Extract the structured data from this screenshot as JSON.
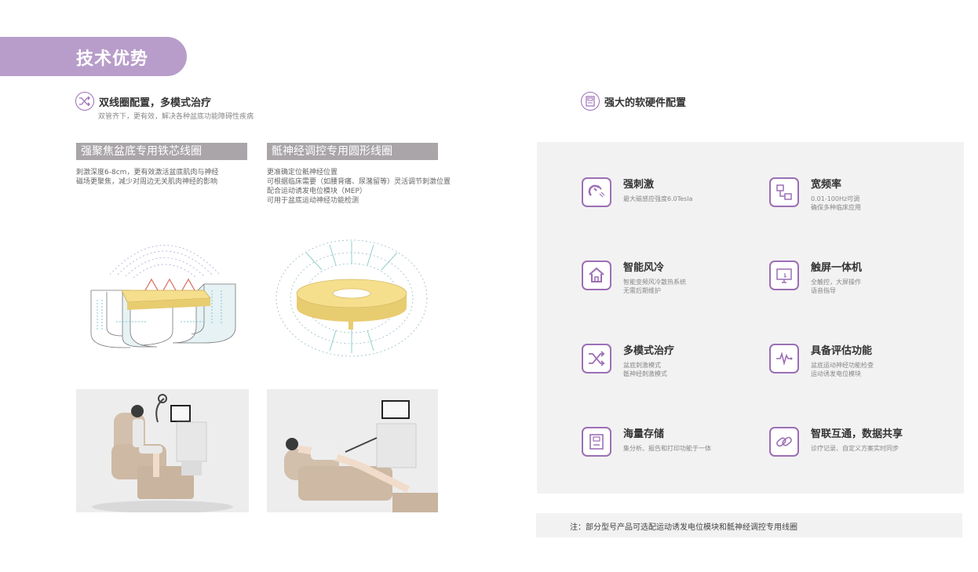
{
  "banner": {
    "title": "技术优势"
  },
  "left_section": {
    "title": "双线圈配置，多模式治疗",
    "subtitle": "双管齐下，更有效，解决各种盆底功能障碍性疾病",
    "coils": [
      {
        "label": "强聚焦盆底专用铁芯线圈",
        "desc": [
          "刺激深度6-8cm，更有效激活盆底肌肉与神经",
          "磁场更聚焦，减少对周边无关肌肉神经的影响"
        ]
      },
      {
        "label": "骶神经调控专用圆形线圈",
        "desc": [
          "更准确定位骶神经位置",
          "可根据临床需要（如腰背痛、尿潴留等）灵活调节刺激位置",
          "配合运动诱发电位模块（MEP）",
          "可用于盆底运动神经功能检测"
        ]
      }
    ]
  },
  "right_section": {
    "title": "强大的软硬件配置",
    "features": [
      {
        "icon": "magnet-icon",
        "title": "强刺激",
        "lines": [
          "最大磁感应强度6.0Tesla"
        ]
      },
      {
        "icon": "frequency-icon",
        "title": "宽频率",
        "lines": [
          "0.01-100Hz可调",
          "确保多种临床应用"
        ]
      },
      {
        "icon": "house-fan-icon",
        "title": "智能风冷",
        "lines": [
          "智能变频风冷散热系统",
          "无需后期维护"
        ]
      },
      {
        "icon": "touchscreen-icon",
        "title": "触屏一体机",
        "lines": [
          "全触控，大屏操作",
          "语音指导"
        ]
      },
      {
        "icon": "shuffle-icon",
        "title": "多模式治疗",
        "lines": [
          "盆底刺激模式",
          "骶神经刺激模式"
        ]
      },
      {
        "icon": "waveform-icon",
        "title": "具备评估功能",
        "lines": [
          "盆底运动神经功能检查",
          "运动诱发电位模块"
        ]
      },
      {
        "icon": "storage-icon",
        "title": "海量存储",
        "lines": [
          "集分析、报告和打印功能于一体"
        ]
      },
      {
        "icon": "link-icon",
        "title": "智联互通，数据共享",
        "lines": [
          "诊疗记录、自定义方案实时同步"
        ]
      }
    ],
    "note": "注：部分型号产品可选配运动诱发电位模块和骶神经调控专用线圈"
  },
  "colors": {
    "accent": "#9c6fb5",
    "banner": "#b89dca",
    "panel": "#f2f2f2",
    "label_bg": "#a9a5a8"
  }
}
